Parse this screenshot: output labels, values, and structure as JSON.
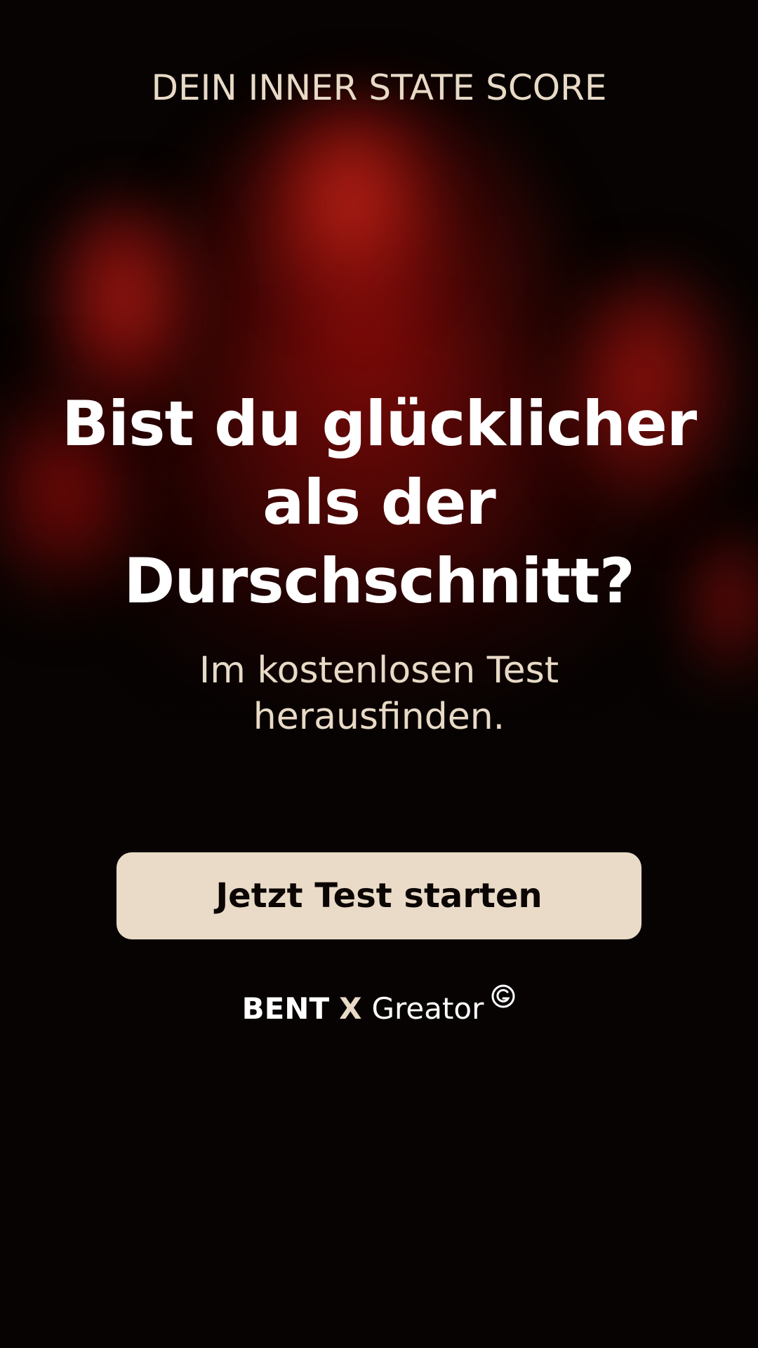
{
  "header": {
    "eyebrow": "DEIN INNER STATE SCORE"
  },
  "hero": {
    "headline_line1": "Bist du glücklicher",
    "headline_line2": "als der",
    "headline_line3": "Durschschnitt?",
    "subline_line1": "Im kostenlosen Test",
    "subline_line2": "herausfinden."
  },
  "cta": {
    "label": "Jetzt Test starten"
  },
  "brand": {
    "left": "BENT",
    "separator": "X",
    "right": "Greator",
    "mark_icon": "greator-g-logo-icon"
  },
  "colors": {
    "background": "#060302",
    "accent_cream": "#e9dbc7",
    "hero_red": "#c8221a",
    "text_white": "#ffffff"
  }
}
